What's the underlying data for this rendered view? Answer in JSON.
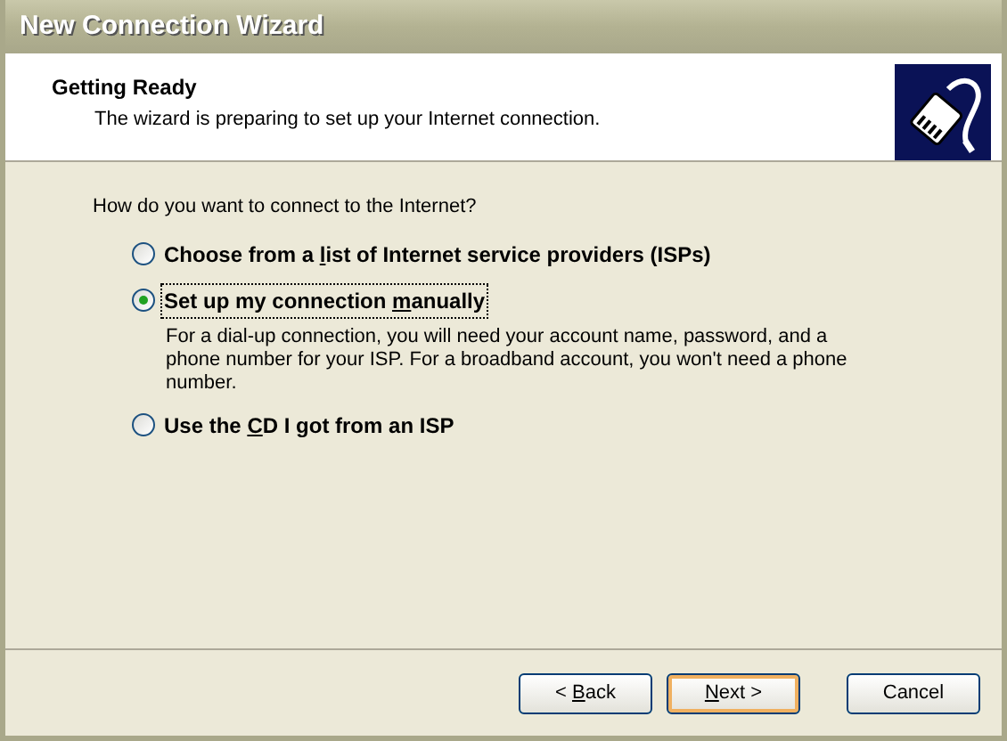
{
  "window": {
    "title": "New Connection Wizard"
  },
  "header": {
    "title": "Getting Ready",
    "subtitle": "The wizard is preparing to set up your Internet connection."
  },
  "question": "How do you want to connect to the Internet?",
  "options": [
    {
      "before": "Choose from a ",
      "key": "l",
      "after": "ist of Internet service providers (ISPs)",
      "selected": false,
      "focused": false
    },
    {
      "before": "Set up my connection ",
      "key": "m",
      "after": "anually",
      "selected": true,
      "focused": true,
      "description": "For a dial-up connection, you will need your account name, password, and a phone number for your ISP. For a broadband account, you won't need a phone number."
    },
    {
      "before": "Use the ",
      "key": "C",
      "after": "D I got from an ISP",
      "selected": false,
      "focused": false
    }
  ],
  "buttons": [
    {
      "before": "< ",
      "key": "B",
      "after": "ack",
      "default": false
    },
    {
      "key": "N",
      "after": "ext >",
      "default": true
    },
    {
      "before": "Cancel",
      "default": false
    }
  ]
}
